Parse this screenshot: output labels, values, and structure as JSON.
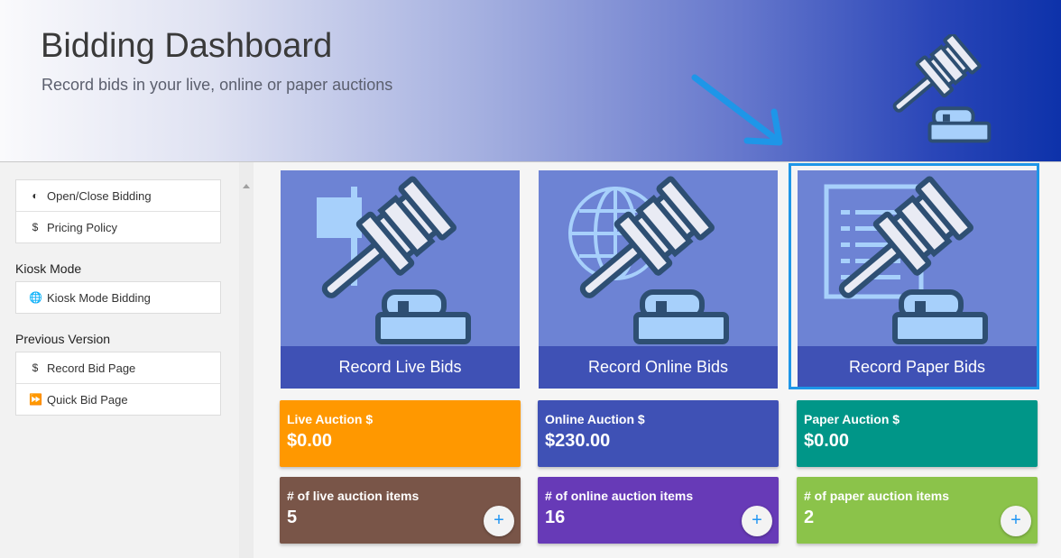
{
  "header": {
    "title": "Bidding Dashboard",
    "subtitle": "Record bids in your live, online or paper auctions"
  },
  "sidebar": {
    "group1": [
      {
        "icon": "toggle-icon",
        "label": "Open/Close Bidding"
      },
      {
        "icon": "dollar-icon",
        "label": "Pricing Policy"
      }
    ],
    "kiosk_heading": "Kiosk Mode",
    "kiosk": [
      {
        "icon": "globe-icon",
        "label": "Kiosk Mode Bidding"
      }
    ],
    "previous_heading": "Previous Version",
    "previous": [
      {
        "icon": "dollar-icon",
        "label": "Record Bid Page"
      },
      {
        "icon": "fast-forward-icon",
        "label": "Quick Bid Page"
      }
    ]
  },
  "tiles": [
    {
      "label": "Record Live Bids",
      "icon": "gavel-with-sign-icon"
    },
    {
      "label": "Record Online Bids",
      "icon": "gavel-with-globe-icon"
    },
    {
      "label": "Record Paper Bids",
      "icon": "gavel-with-paper-icon",
      "highlighted": true
    }
  ],
  "totals": [
    {
      "label": "Live Auction $",
      "value": "$0.00",
      "color": "#ff9800"
    },
    {
      "label": "Online Auction $",
      "value": "$230.00",
      "color": "#3f51b5"
    },
    {
      "label": "Paper Auction $",
      "value": "$0.00",
      "color": "#009688"
    }
  ],
  "counts": [
    {
      "label": "# of live auction items",
      "value": "5",
      "color": "#795548",
      "button": "+"
    },
    {
      "label": "# of online auction items",
      "value": "16",
      "color": "#673ab7",
      "button": "+"
    },
    {
      "label": "# of paper auction items",
      "value": "2",
      "color": "#8bc34a",
      "button": "+"
    }
  ],
  "colors": {
    "accent_highlight": "#1e96e8",
    "tile_bg": "#6d83d4",
    "tile_band": "#3f51b5"
  }
}
